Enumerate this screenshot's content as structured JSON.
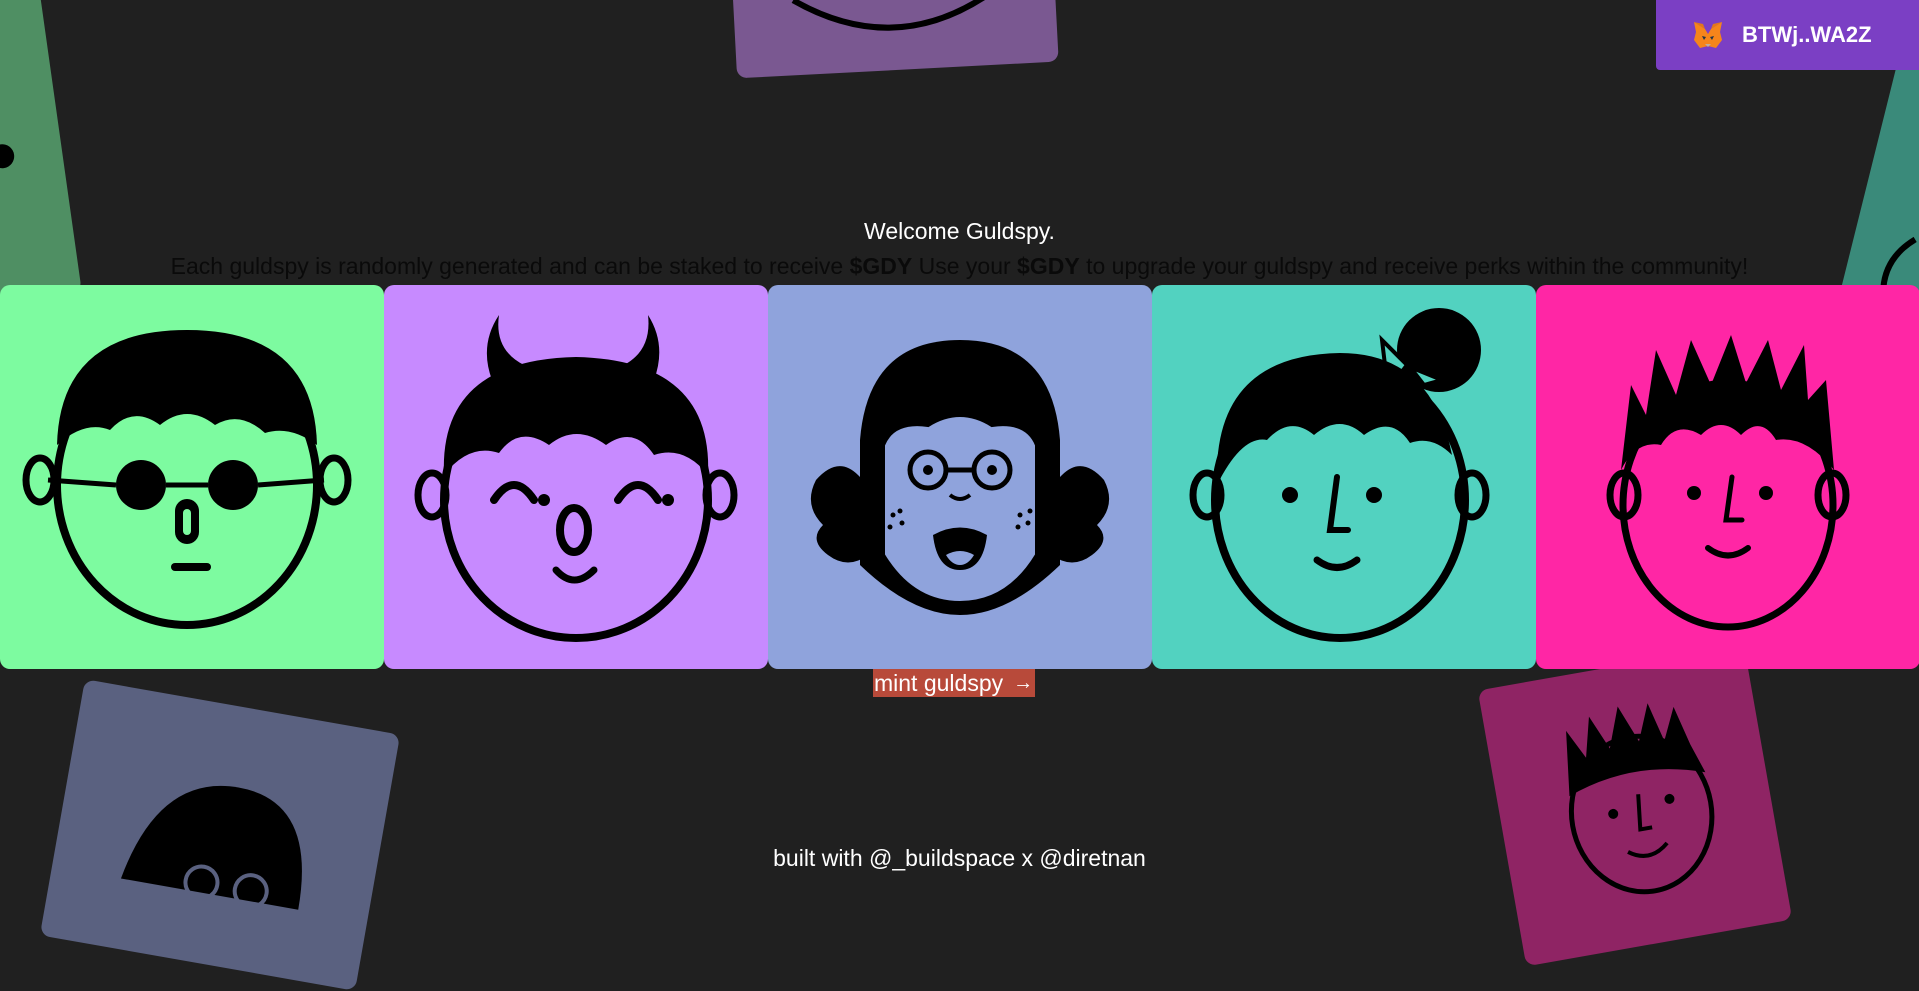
{
  "wallet": {
    "label": "BTWj..WA2Z",
    "icon": "metamask-fox-icon"
  },
  "hero": {
    "welcome": "Welcome Guldspy.",
    "desc_part1": "Each guldspy is randomly generated and can be staked to receive ",
    "token1": "$GDY",
    "desc_part2": " Use your ",
    "token2": "$GDY",
    "desc_part3": " to upgrade your guldspy and receive perks within the community!"
  },
  "tiles": [
    {
      "name": "green-glasses-face",
      "color": "#7dfba0"
    },
    {
      "name": "purple-horned-face",
      "color": "#c78aff"
    },
    {
      "name": "blue-glasses-girl-face",
      "color": "#8fa3dc"
    },
    {
      "name": "teal-bow-face",
      "color": "#52d2c0"
    },
    {
      "name": "pink-spiky-face",
      "color": "#ff26a5"
    }
  ],
  "mint": {
    "label": "mint guldspy",
    "arrow": "→"
  },
  "footer": {
    "text": "built with @_buildspace x @diretnan"
  },
  "colors": {
    "background": "#202020",
    "wallet": "#7b3fc4",
    "mint": "#b84a3a"
  }
}
